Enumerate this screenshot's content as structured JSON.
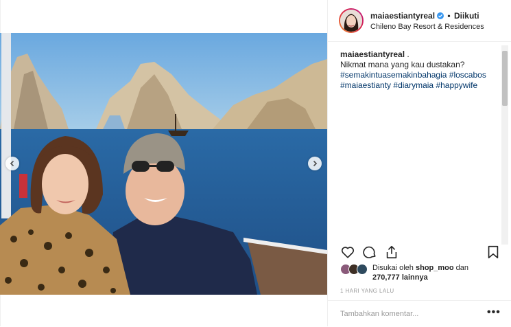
{
  "post": {
    "username": "maiaestiantyreal",
    "separator": "•",
    "follow_status": "Diikuti",
    "location": "Chileno Bay Resort & Residences",
    "verified_icon": "verified-badge-icon"
  },
  "caption": {
    "username": "maiaestiantyreal",
    "after_username": " .",
    "line1": "Nikmat mana yang kau dustakan?",
    "hashtags_line1": [
      "#semakintuasemakinbahagia",
      "#loscabos"
    ],
    "hashtags_line2": [
      "#maiaestianty",
      "#diarymaia",
      "#happywife"
    ]
  },
  "icons": {
    "like": "heart-icon",
    "comment": "comment-icon",
    "share": "share-icon",
    "save": "bookmark-icon",
    "prev": "chevron-left-icon",
    "next": "chevron-right-icon"
  },
  "likes": {
    "prefix": "Disukai oleh ",
    "user": "shop_moo",
    "middle": " dan",
    "count": "270,777",
    "suffix": " lainnya"
  },
  "timestamp": "1 HARI YANG LALU",
  "comment": {
    "placeholder": "Tambahkan komentar...",
    "more_label": "•••"
  },
  "colors": {
    "hashtag": "#003569",
    "verified": "#3897f0",
    "sea": "#2c5f9e",
    "sky": "#7fb4e0"
  }
}
